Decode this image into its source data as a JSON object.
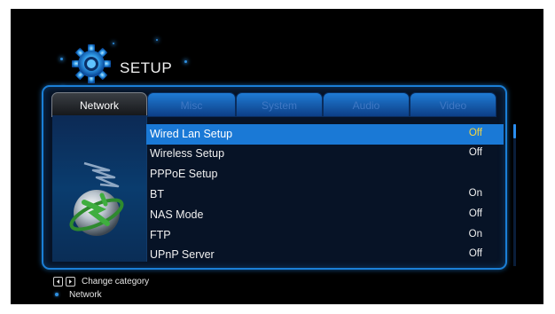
{
  "header": {
    "title": "SETUP",
    "icon": "gear-icon"
  },
  "tabs": [
    {
      "label": "Network",
      "active": true
    },
    {
      "label": "Misc",
      "active": false
    },
    {
      "label": "System",
      "active": false
    },
    {
      "label": "Audio",
      "active": false
    },
    {
      "label": "Video",
      "active": false
    }
  ],
  "menu": {
    "items": [
      {
        "label": "Wired Lan Setup",
        "value": "Off",
        "selected": true
      },
      {
        "label": "Wireless Setup",
        "value": "Off",
        "selected": false
      },
      {
        "label": "PPPoE Setup",
        "value": "",
        "selected": false
      },
      {
        "label": "BT",
        "value": "On",
        "selected": false
      },
      {
        "label": "NAS Mode",
        "value": "Off",
        "selected": false
      },
      {
        "label": "FTP",
        "value": "On",
        "selected": false
      },
      {
        "label": "UPnP Server",
        "value": "Off",
        "selected": false
      }
    ]
  },
  "footer": {
    "hint": "Change category",
    "current": "Network"
  },
  "colors": {
    "accent": "#1a79d6",
    "selected_value": "#f5d640",
    "background": "#000000"
  }
}
